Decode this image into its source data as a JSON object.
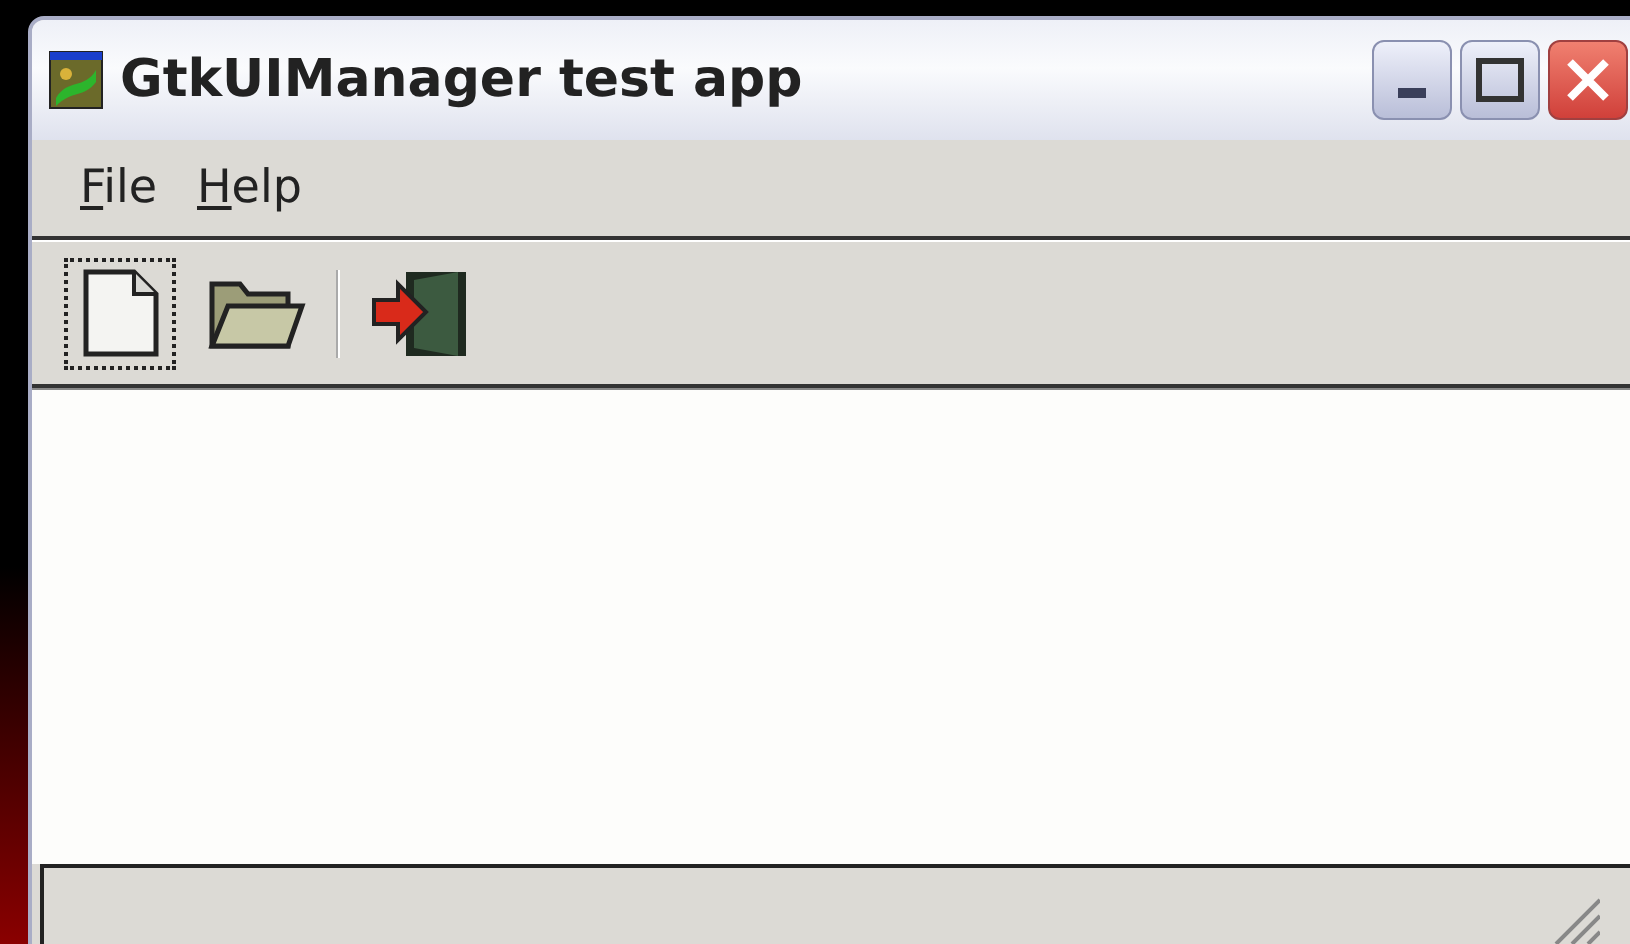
{
  "window": {
    "title": "GtkUIManager test app"
  },
  "menu": [
    {
      "label": "File",
      "first_letter_underlined": true
    },
    {
      "label": "Help",
      "first_letter_underlined": true
    }
  ],
  "toolbar": [
    {
      "kind": "new",
      "focused": true
    },
    {
      "kind": "open",
      "focused": false
    },
    {
      "kind": "separator"
    },
    {
      "kind": "quit",
      "focused": false
    }
  ]
}
